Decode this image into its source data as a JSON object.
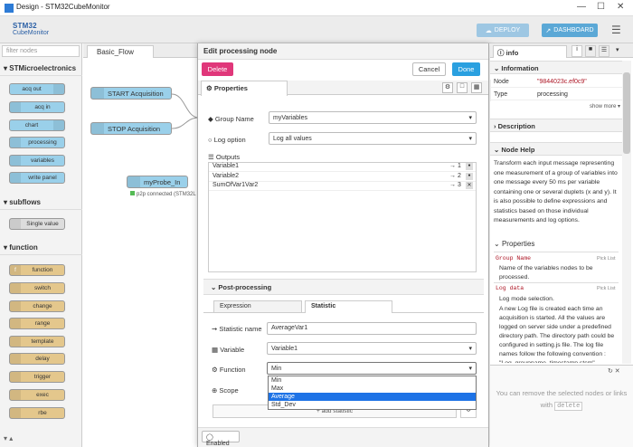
{
  "window": {
    "title": "Design - STM32CubeMonitor"
  },
  "header": {
    "logo_line1": "STM32",
    "logo_line2": "CubeMonitor",
    "deploy_label": "DEPLOY",
    "dashboard_label": "DASHBOARD"
  },
  "palette": {
    "filter_placeholder": "filter nodes",
    "categories": [
      {
        "label": "STMicroelectronics",
        "items": [
          "acq out",
          "acq in",
          "chart",
          "processing",
          "variables",
          "write panel"
        ]
      },
      {
        "label": "subflows",
        "items": [
          "Single value"
        ]
      },
      {
        "label": "function",
        "items": [
          "function",
          "switch",
          "change",
          "range",
          "template",
          "delay",
          "trigger",
          "exec",
          "rbe"
        ]
      }
    ]
  },
  "workspace": {
    "tab": "Basic_Flow",
    "nodes": [
      "START Acquisition",
      "STOP Acquisition",
      "myProbe_In"
    ],
    "status": "p2p connected (STM32L"
  },
  "tray": {
    "title": "Edit processing node",
    "delete_label": "Delete",
    "cancel_label": "Cancel",
    "done_label": "Done",
    "properties_tab": "Properties",
    "group_name_label": "Group Name",
    "group_name_value": "myVariables",
    "log_option_label": "Log option",
    "log_option_value": "Log all values",
    "outputs_label": "Outputs",
    "outputs": [
      {
        "name": "Variable1",
        "port": "→ 1"
      },
      {
        "name": "Variable2",
        "port": "→ 2"
      },
      {
        "name": "SumOfVar1Var2",
        "port": "→ 3"
      }
    ],
    "post_processing_label": "Post-processing",
    "subtabs": [
      "Expression",
      "Statistic"
    ],
    "statistic_name_label": "Statistic name",
    "statistic_name_value": "AverageVar1",
    "variable_label": "Variable",
    "variable_value": "Variable1",
    "function_label": "Function",
    "function_value": "Min",
    "function_options": [
      "Min",
      "Max",
      "Average",
      "Std_Dev"
    ],
    "function_selected": "Average",
    "scope_label": "Scope",
    "add_statistic_label": "add statistic",
    "enabled_label": "Enabled"
  },
  "sidebar": {
    "tab_label": "info",
    "information_header": "Information",
    "info_rows": [
      {
        "key": "Node",
        "value": "\"9844023c.ef0c9\""
      },
      {
        "key": "Type",
        "value": "processing"
      }
    ],
    "show_more": "show more",
    "description_header": "Description",
    "node_help_header": "Node Help",
    "help_text": "Transform each input message representing one measurement of a group of variables into one message every 50 ms per variable containing one or several duplets (x and y). It is also possible to define expressions and statistics based on those individual measurements and log options.",
    "properties_header": "Properties",
    "prop1_name": "Group Name",
    "prop1_tag": "Pick List",
    "prop1_desc": "Name of the variables nodes to be processed.",
    "prop2_name": "Log data",
    "prop2_tag": "Pick List",
    "prop2_desc1": "Log mode selection.",
    "prop2_desc2": "A new Log file is created each time an acquisition is started. All the values are logged on server side under a predefined directory path. The directory path could be configured in setting.js file. The log file names follow the following convention : \"Log_groupname_timestamp.stcm\"",
    "hint_text": "You can remove the selected nodes or links with",
    "hint_key": "delete"
  },
  "colors": {
    "delete_btn": "#e0377a",
    "done_btn": "#2aa0e0",
    "header_btn": "#5ba8d6",
    "selected_option": "#1e73e6"
  }
}
